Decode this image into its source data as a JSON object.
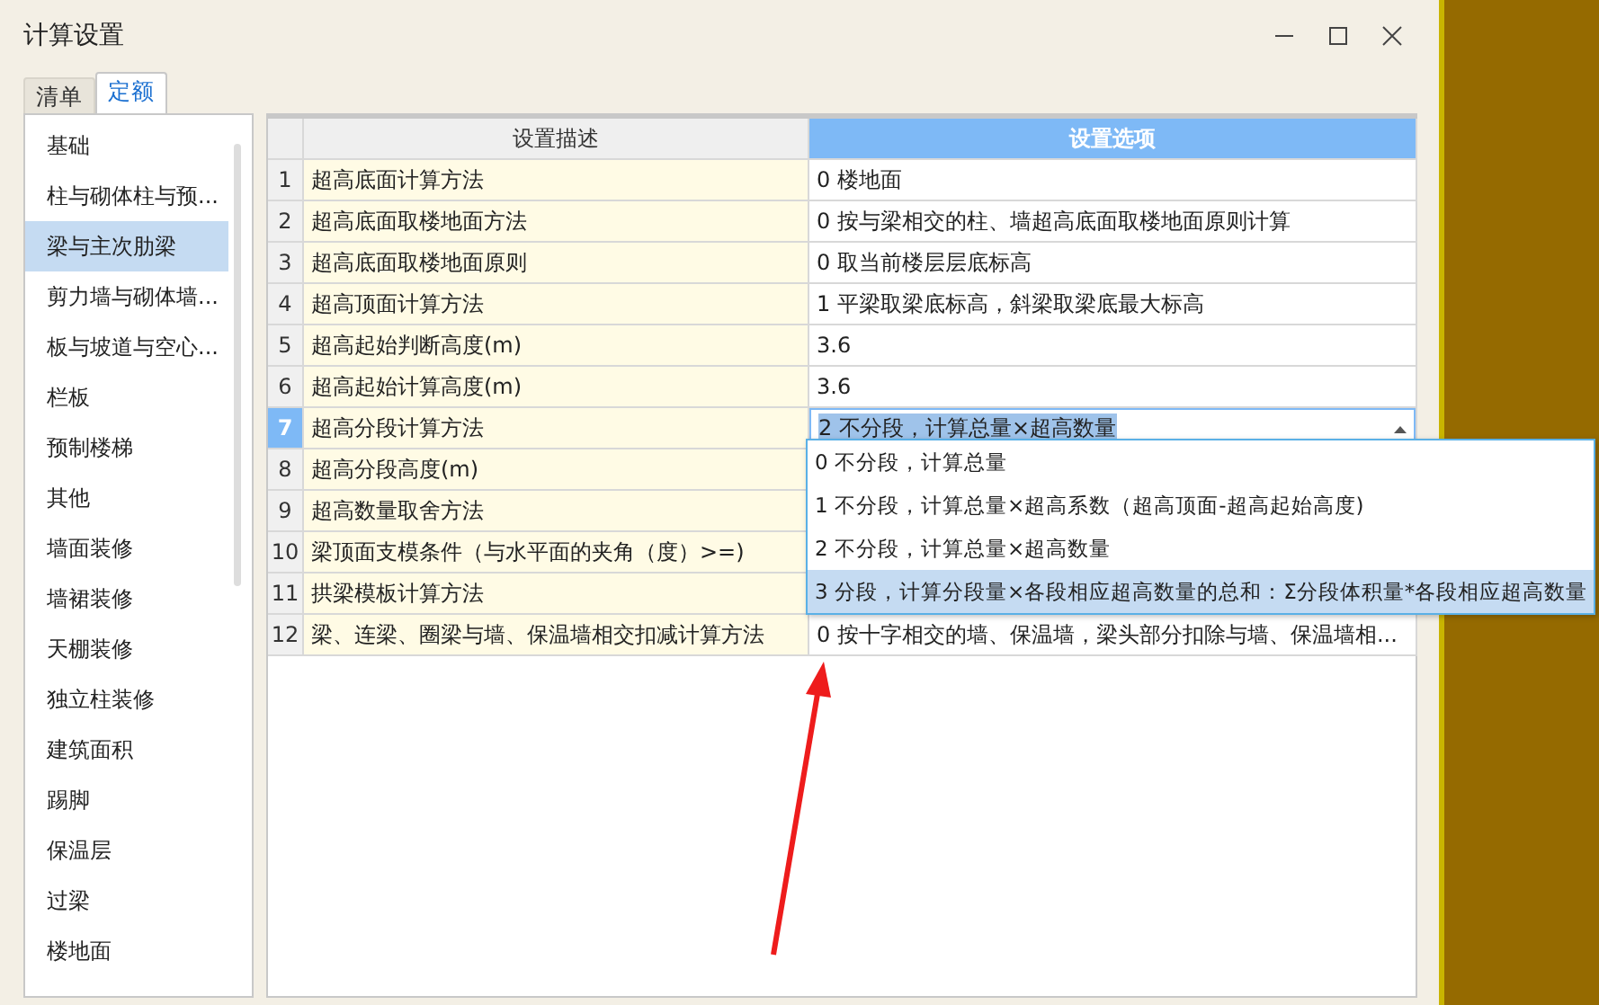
{
  "window": {
    "title": "计算设置"
  },
  "tabs": [
    {
      "label": "清单",
      "selected": false
    },
    {
      "label": "定额",
      "selected": true
    }
  ],
  "sidebar": {
    "items": [
      {
        "label": "基础",
        "selected": false
      },
      {
        "label": "柱与砌体柱与预...",
        "selected": false
      },
      {
        "label": "梁与主次肋梁",
        "selected": true
      },
      {
        "label": "剪力墙与砌体墙...",
        "selected": false
      },
      {
        "label": "板与坡道与空心...",
        "selected": false
      },
      {
        "label": "栏板",
        "selected": false
      },
      {
        "label": "预制楼梯",
        "selected": false
      },
      {
        "label": "其他",
        "selected": false
      },
      {
        "label": "墙面装修",
        "selected": false
      },
      {
        "label": "墙裙装修",
        "selected": false
      },
      {
        "label": "天棚装修",
        "selected": false
      },
      {
        "label": "独立柱装修",
        "selected": false
      },
      {
        "label": "建筑面积",
        "selected": false
      },
      {
        "label": "踢脚",
        "selected": false
      },
      {
        "label": "保温层",
        "selected": false
      },
      {
        "label": "过梁",
        "selected": false
      },
      {
        "label": "楼地面",
        "selected": false
      }
    ]
  },
  "table": {
    "columns": [
      {
        "label": "设置描述",
        "selected": false
      },
      {
        "label": "设置选项",
        "selected": true
      }
    ],
    "rows": [
      {
        "number": "1",
        "description": "超高底面计算方法",
        "option": "0 楼地面",
        "selected": false
      },
      {
        "number": "2",
        "description": "超高底面取楼地面方法",
        "option": "0 按与梁相交的柱、墙超高底面取楼地面原则计算",
        "selected": false
      },
      {
        "number": "3",
        "description": "超高底面取楼地面原则",
        "option": "0 取当前楼层层底标高",
        "selected": false
      },
      {
        "number": "4",
        "description": "超高顶面计算方法",
        "option": "1 平梁取梁底标高，斜梁取梁底最大标高",
        "selected": false
      },
      {
        "number": "5",
        "description": "超高起始判断高度(m)",
        "option": "3.6",
        "selected": false
      },
      {
        "number": "6",
        "description": "超高起始计算高度(m)",
        "option": "3.6",
        "selected": false
      },
      {
        "number": "7",
        "description": "超高分段计算方法",
        "option": "2 不分段，计算总量×超高数量",
        "selected": true
      },
      {
        "number": "8",
        "description": "超高分段高度(m)",
        "selected": false
      },
      {
        "number": "9",
        "description": "超高数量取舍方法",
        "selected": false
      },
      {
        "number": "10",
        "description": "梁顶面支模条件（与水平面的夹角（度）>=)",
        "selected": false
      },
      {
        "number": "11",
        "description": "拱梁模板计算方法",
        "selected": false
      },
      {
        "number": "12",
        "description": "梁、连梁、圈梁与墙、保温墙相交扣减计算方法",
        "option": "0 按十字相交的墙、保温墙，梁头部分扣除与墙、保温墙相...",
        "selected": false
      }
    ]
  },
  "dropdown": {
    "items": [
      {
        "label": "0 不分段，计算总量",
        "selected": false
      },
      {
        "label": "1 不分段，计算总量×超高系数（超高顶面-超高起始高度)",
        "selected": false
      },
      {
        "label": "2 不分段，计算总量×超高数量",
        "selected": false
      },
      {
        "label": "3 分段，计算分段量×各段相应超高数量的总和：Σ分段体积量*各段相应超高数量",
        "selected": true
      }
    ]
  }
}
